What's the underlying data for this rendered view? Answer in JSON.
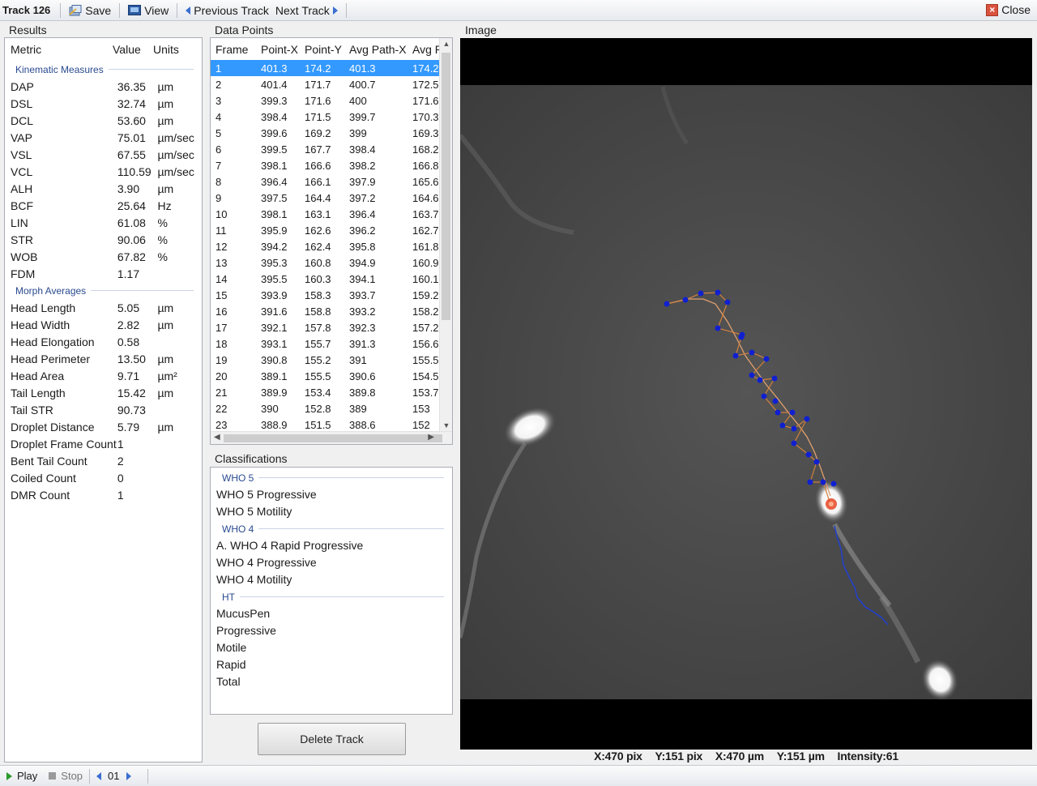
{
  "toolbar": {
    "title": "Track 126",
    "save_label": "Save",
    "view_label": "View",
    "prev_label": "Previous Track",
    "next_label": "Next Track",
    "close_label": "Close"
  },
  "results": {
    "group_label": "Results",
    "headers": {
      "metric": "Metric",
      "value": "Value",
      "units": "Units"
    },
    "kinematic_label": "Kinematic Measures",
    "kinematic": [
      {
        "metric": "DAP",
        "value": "36.35",
        "units": "µm"
      },
      {
        "metric": "DSL",
        "value": "32.74",
        "units": "µm"
      },
      {
        "metric": "DCL",
        "value": "53.60",
        "units": "µm"
      },
      {
        "metric": "VAP",
        "value": "75.01",
        "units": "µm/sec"
      },
      {
        "metric": "VSL",
        "value": "67.55",
        "units": "µm/sec"
      },
      {
        "metric": "VCL",
        "value": "110.59",
        "units": "µm/sec"
      },
      {
        "metric": "ALH",
        "value": "3.90",
        "units": "µm"
      },
      {
        "metric": "BCF",
        "value": "25.64",
        "units": "Hz"
      },
      {
        "metric": "LIN",
        "value": "61.08",
        "units": "%"
      },
      {
        "metric": "STR",
        "value": "90.06",
        "units": "%"
      },
      {
        "metric": "WOB",
        "value": "67.82",
        "units": "%"
      },
      {
        "metric": "FDM",
        "value": "1.17",
        "units": ""
      }
    ],
    "morph_label": "Morph Averages",
    "morph": [
      {
        "metric": "Head Length",
        "value": "5.05",
        "units": "µm"
      },
      {
        "metric": "Head Width",
        "value": "2.82",
        "units": "µm"
      },
      {
        "metric": "Head Elongation",
        "value": "0.58",
        "units": ""
      },
      {
        "metric": "Head Perimeter",
        "value": "13.50",
        "units": "µm"
      },
      {
        "metric": "Head Area",
        "value": "9.71",
        "units": "µm²"
      },
      {
        "metric": "Tail Length",
        "value": "15.42",
        "units": "µm"
      },
      {
        "metric": "Tail STR",
        "value": "90.73",
        "units": ""
      },
      {
        "metric": "Droplet Distance",
        "value": "5.79",
        "units": "µm"
      },
      {
        "metric": "Droplet Frame Count",
        "value": "1",
        "units": ""
      },
      {
        "metric": "Bent Tail Count",
        "value": "2",
        "units": ""
      },
      {
        "metric": "Coiled Count",
        "value": "0",
        "units": ""
      },
      {
        "metric": "DMR Count",
        "value": "1",
        "units": ""
      }
    ]
  },
  "datapoints": {
    "group_label": "Data Points",
    "headers": [
      "Frame",
      "Point-X",
      "Point-Y",
      "Avg Path-X",
      "Avg Pa"
    ],
    "rows": [
      [
        "1",
        "401.3",
        "174.2",
        "401.3",
        "174.2"
      ],
      [
        "2",
        "401.4",
        "171.7",
        "400.7",
        "172.5"
      ],
      [
        "3",
        "399.3",
        "171.6",
        "400",
        "171.6"
      ],
      [
        "4",
        "398.4",
        "171.5",
        "399.7",
        "170.3"
      ],
      [
        "5",
        "399.6",
        "169.2",
        "399",
        "169.3"
      ],
      [
        "6",
        "399.5",
        "167.7",
        "398.4",
        "168.2"
      ],
      [
        "7",
        "398.1",
        "166.6",
        "398.2",
        "166.8"
      ],
      [
        "8",
        "396.4",
        "166.1",
        "397.9",
        "165.6"
      ],
      [
        "9",
        "397.5",
        "164.4",
        "397.2",
        "164.6"
      ],
      [
        "10",
        "398.1",
        "163.1",
        "396.4",
        "163.7"
      ],
      [
        "11",
        "395.9",
        "162.6",
        "396.2",
        "162.7"
      ],
      [
        "12",
        "394.2",
        "162.4",
        "395.8",
        "161.8"
      ],
      [
        "13",
        "395.3",
        "160.8",
        "394.9",
        "160.9"
      ],
      [
        "14",
        "395.5",
        "160.3",
        "394.1",
        "160.1"
      ],
      [
        "15",
        "393.9",
        "158.3",
        "393.7",
        "159.2"
      ],
      [
        "16",
        "391.6",
        "158.8",
        "393.2",
        "158.2"
      ],
      [
        "17",
        "392.1",
        "157.8",
        "392.3",
        "157.2"
      ],
      [
        "18",
        "393.1",
        "155.7",
        "391.3",
        "156.6"
      ],
      [
        "19",
        "390.8",
        "155.2",
        "391",
        "155.5"
      ],
      [
        "20",
        "389.1",
        "155.5",
        "390.6",
        "154.5"
      ],
      [
        "21",
        "389.9",
        "153.4",
        "389.8",
        "153.7"
      ],
      [
        "22",
        "390",
        "152.8",
        "389",
        "153"
      ],
      [
        "23",
        "388.9",
        "151.5",
        "388.6",
        "152"
      ]
    ]
  },
  "classifications": {
    "group_label": "Classifications",
    "sections": [
      {
        "label": "WHO 5",
        "items": [
          "WHO 5 Progressive",
          "WHO 5 Motility"
        ]
      },
      {
        "label": "WHO 4",
        "items": [
          "A. WHO 4 Rapid Progressive",
          "WHO 4 Progressive",
          "WHO 4 Motility"
        ]
      },
      {
        "label": "HT",
        "items": [
          "MucusPen",
          "Progressive",
          "Motile",
          "Rapid",
          "Total"
        ]
      }
    ]
  },
  "delete_label": "Delete Track",
  "image": {
    "group_label": "Image",
    "coords": {
      "xpix": "X:470 pix",
      "ypix": "Y:151 pix",
      "xum": "X:470 µm",
      "yum": "Y:151 µm",
      "intensity": "Intensity:61"
    }
  },
  "playback": {
    "play_label": "Play",
    "stop_label": "Stop",
    "frame": "01"
  },
  "colors": {
    "selection": "#3399ff",
    "track_points": "#1020d0",
    "avg_path": "#d08040",
    "tail_trace": "#2040d0",
    "head_marker": "#e85030"
  }
}
